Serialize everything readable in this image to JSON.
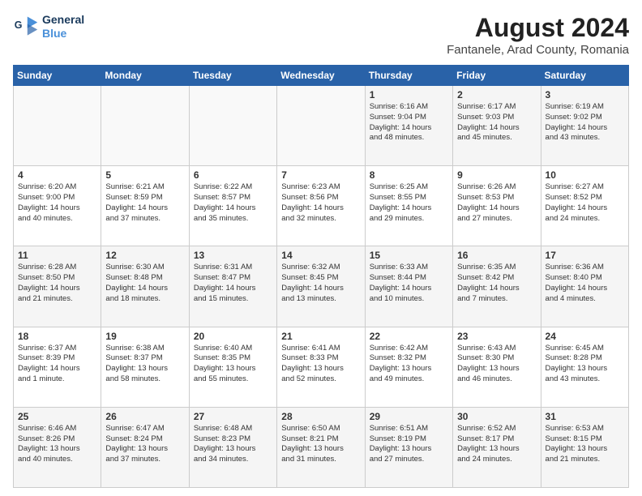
{
  "logo": {
    "line1": "General",
    "line2": "Blue"
  },
  "title": "August 2024",
  "subtitle": "Fantanele, Arad County, Romania",
  "weekdays": [
    "Sunday",
    "Monday",
    "Tuesday",
    "Wednesday",
    "Thursday",
    "Friday",
    "Saturday"
  ],
  "weeks": [
    [
      {
        "day": "",
        "info": ""
      },
      {
        "day": "",
        "info": ""
      },
      {
        "day": "",
        "info": ""
      },
      {
        "day": "",
        "info": ""
      },
      {
        "day": "1",
        "info": "Sunrise: 6:16 AM\nSunset: 9:04 PM\nDaylight: 14 hours\nand 48 minutes."
      },
      {
        "day": "2",
        "info": "Sunrise: 6:17 AM\nSunset: 9:03 PM\nDaylight: 14 hours\nand 45 minutes."
      },
      {
        "day": "3",
        "info": "Sunrise: 6:19 AM\nSunset: 9:02 PM\nDaylight: 14 hours\nand 43 minutes."
      }
    ],
    [
      {
        "day": "4",
        "info": "Sunrise: 6:20 AM\nSunset: 9:00 PM\nDaylight: 14 hours\nand 40 minutes."
      },
      {
        "day": "5",
        "info": "Sunrise: 6:21 AM\nSunset: 8:59 PM\nDaylight: 14 hours\nand 37 minutes."
      },
      {
        "day": "6",
        "info": "Sunrise: 6:22 AM\nSunset: 8:57 PM\nDaylight: 14 hours\nand 35 minutes."
      },
      {
        "day": "7",
        "info": "Sunrise: 6:23 AM\nSunset: 8:56 PM\nDaylight: 14 hours\nand 32 minutes."
      },
      {
        "day": "8",
        "info": "Sunrise: 6:25 AM\nSunset: 8:55 PM\nDaylight: 14 hours\nand 29 minutes."
      },
      {
        "day": "9",
        "info": "Sunrise: 6:26 AM\nSunset: 8:53 PM\nDaylight: 14 hours\nand 27 minutes."
      },
      {
        "day": "10",
        "info": "Sunrise: 6:27 AM\nSunset: 8:52 PM\nDaylight: 14 hours\nand 24 minutes."
      }
    ],
    [
      {
        "day": "11",
        "info": "Sunrise: 6:28 AM\nSunset: 8:50 PM\nDaylight: 14 hours\nand 21 minutes."
      },
      {
        "day": "12",
        "info": "Sunrise: 6:30 AM\nSunset: 8:48 PM\nDaylight: 14 hours\nand 18 minutes."
      },
      {
        "day": "13",
        "info": "Sunrise: 6:31 AM\nSunset: 8:47 PM\nDaylight: 14 hours\nand 15 minutes."
      },
      {
        "day": "14",
        "info": "Sunrise: 6:32 AM\nSunset: 8:45 PM\nDaylight: 14 hours\nand 13 minutes."
      },
      {
        "day": "15",
        "info": "Sunrise: 6:33 AM\nSunset: 8:44 PM\nDaylight: 14 hours\nand 10 minutes."
      },
      {
        "day": "16",
        "info": "Sunrise: 6:35 AM\nSunset: 8:42 PM\nDaylight: 14 hours\nand 7 minutes."
      },
      {
        "day": "17",
        "info": "Sunrise: 6:36 AM\nSunset: 8:40 PM\nDaylight: 14 hours\nand 4 minutes."
      }
    ],
    [
      {
        "day": "18",
        "info": "Sunrise: 6:37 AM\nSunset: 8:39 PM\nDaylight: 14 hours\nand 1 minute."
      },
      {
        "day": "19",
        "info": "Sunrise: 6:38 AM\nSunset: 8:37 PM\nDaylight: 13 hours\nand 58 minutes."
      },
      {
        "day": "20",
        "info": "Sunrise: 6:40 AM\nSunset: 8:35 PM\nDaylight: 13 hours\nand 55 minutes."
      },
      {
        "day": "21",
        "info": "Sunrise: 6:41 AM\nSunset: 8:33 PM\nDaylight: 13 hours\nand 52 minutes."
      },
      {
        "day": "22",
        "info": "Sunrise: 6:42 AM\nSunset: 8:32 PM\nDaylight: 13 hours\nand 49 minutes."
      },
      {
        "day": "23",
        "info": "Sunrise: 6:43 AM\nSunset: 8:30 PM\nDaylight: 13 hours\nand 46 minutes."
      },
      {
        "day": "24",
        "info": "Sunrise: 6:45 AM\nSunset: 8:28 PM\nDaylight: 13 hours\nand 43 minutes."
      }
    ],
    [
      {
        "day": "25",
        "info": "Sunrise: 6:46 AM\nSunset: 8:26 PM\nDaylight: 13 hours\nand 40 minutes."
      },
      {
        "day": "26",
        "info": "Sunrise: 6:47 AM\nSunset: 8:24 PM\nDaylight: 13 hours\nand 37 minutes."
      },
      {
        "day": "27",
        "info": "Sunrise: 6:48 AM\nSunset: 8:23 PM\nDaylight: 13 hours\nand 34 minutes."
      },
      {
        "day": "28",
        "info": "Sunrise: 6:50 AM\nSunset: 8:21 PM\nDaylight: 13 hours\nand 31 minutes."
      },
      {
        "day": "29",
        "info": "Sunrise: 6:51 AM\nSunset: 8:19 PM\nDaylight: 13 hours\nand 27 minutes."
      },
      {
        "day": "30",
        "info": "Sunrise: 6:52 AM\nSunset: 8:17 PM\nDaylight: 13 hours\nand 24 minutes."
      },
      {
        "day": "31",
        "info": "Sunrise: 6:53 AM\nSunset: 8:15 PM\nDaylight: 13 hours\nand 21 minutes."
      }
    ]
  ]
}
